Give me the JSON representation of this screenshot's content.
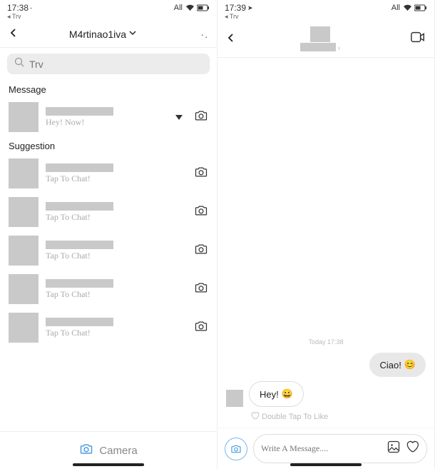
{
  "left": {
    "status": {
      "time": "17:38",
      "net": "All",
      "return": "◂ Trv"
    },
    "header": {
      "title": "M4rtinao1iva"
    },
    "search": {
      "placeholder": "Trv"
    },
    "sections": {
      "message_title": "Message",
      "suggestion_title": "Suggestion"
    },
    "messages": [
      {
        "preview": "Hey! Now!",
        "unread": true
      }
    ],
    "suggestions": [
      {
        "preview": "Tap To Chat!"
      },
      {
        "preview": "Tap To Chat!"
      },
      {
        "preview": "Tap To Chat!"
      },
      {
        "preview": "Tap To Chat!"
      },
      {
        "preview": "Tap To Chat!"
      }
    ],
    "bottom": {
      "camera": "Camera"
    }
  },
  "right": {
    "status": {
      "time": "17:39",
      "net": "All",
      "return": "◂ Trv"
    },
    "conversation": {
      "timestamp": "Today 17:38",
      "sent": "Ciao!",
      "received": "Hey!",
      "double_tap": "Double Tap To Like"
    },
    "input": {
      "placeholder": "Write A Message...."
    }
  }
}
